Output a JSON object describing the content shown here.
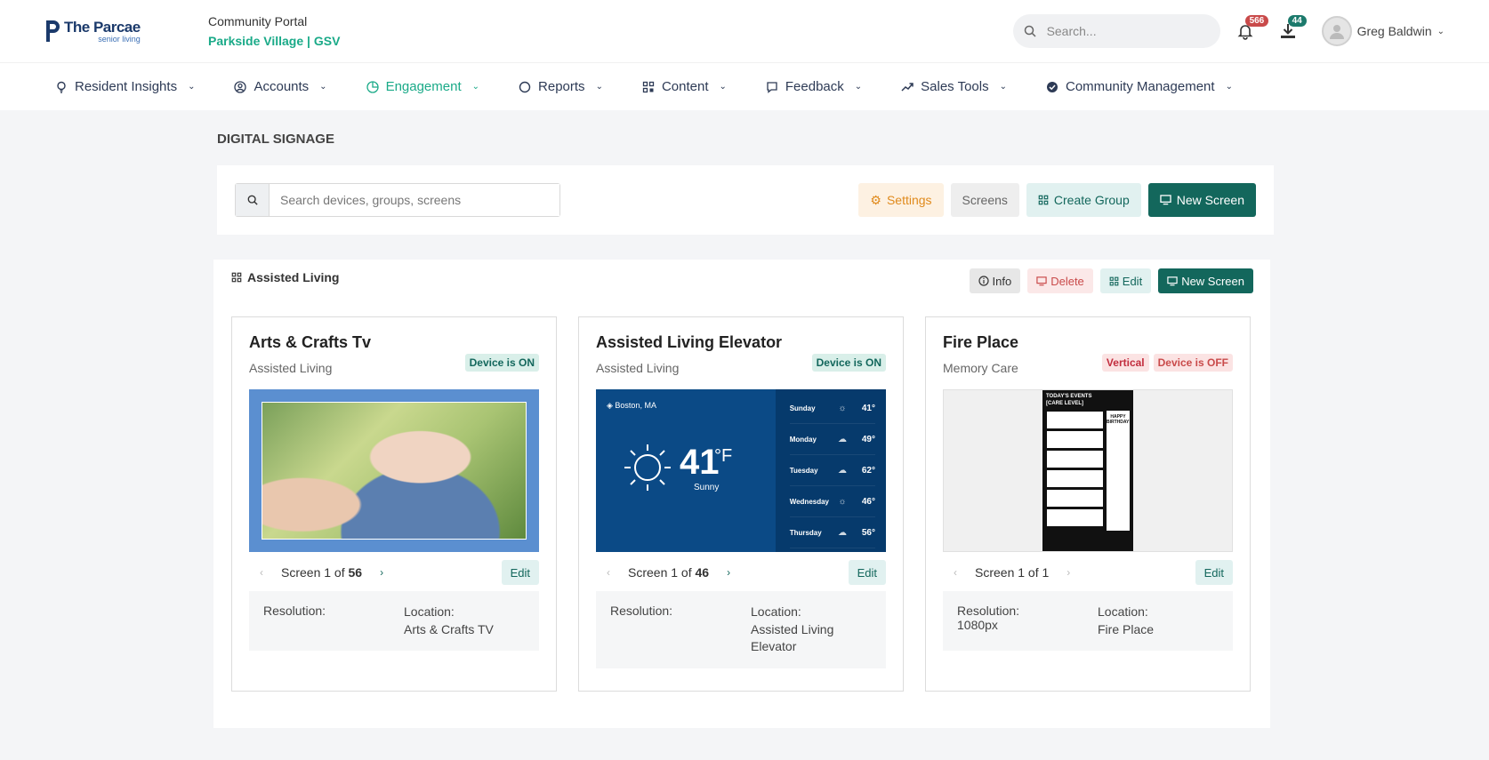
{
  "brand": {
    "name": "The Parcae",
    "tagline": "senior living"
  },
  "portal": {
    "title": "Community Portal",
    "community": "Parkside Village | GSV"
  },
  "header": {
    "search_placeholder": "Search...",
    "notifications_count": "566",
    "downloads_count": "44",
    "user_name": "Greg Baldwin"
  },
  "nav": [
    {
      "label": "Resident Insights",
      "icon": "bulb-icon"
    },
    {
      "label": "Accounts",
      "icon": "user-circle-icon"
    },
    {
      "label": "Engagement",
      "icon": "engagement-icon",
      "active": true
    },
    {
      "label": "Reports",
      "icon": "circle-icon"
    },
    {
      "label": "Content",
      "icon": "grid-icon"
    },
    {
      "label": "Feedback",
      "icon": "comment-icon"
    },
    {
      "label": "Sales Tools",
      "icon": "trend-icon"
    },
    {
      "label": "Community Management",
      "icon": "check-badge-icon"
    }
  ],
  "page": {
    "title": "DIGITAL SIGNAGE"
  },
  "toolbar": {
    "search_placeholder": "Search devices, groups, screens",
    "settings_label": "Settings",
    "screens_label": "Screens",
    "create_group_label": "Create Group",
    "new_screen_label": "New Screen"
  },
  "group": {
    "title": "Assisted Living",
    "info_label": "Info",
    "delete_label": "Delete",
    "edit_label": "Edit",
    "new_screen_label": "New Screen"
  },
  "devices": [
    {
      "name": "Arts & Crafts Tv",
      "group": "Assisted Living",
      "tags": [
        "Device is ON"
      ],
      "screen_prefix": "Screen 1 of ",
      "screen_total": "56",
      "edit_label": "Edit",
      "resolution_label": "Resolution:",
      "resolution": "",
      "location_label": "Location:",
      "location": "Arts & Crafts TV"
    },
    {
      "name": "Assisted Living Elevator",
      "group": "Assisted Living",
      "tags": [
        "Device is ON"
      ],
      "screen_prefix": "Screen 1 of ",
      "screen_total": "46",
      "edit_label": "Edit",
      "resolution_label": "Resolution:",
      "resolution": "",
      "location_label": "Location:",
      "location": "Assisted Living Elevator"
    },
    {
      "name": "Fire Place",
      "group": "Memory Care",
      "tags": [
        "Vertical",
        "Device is OFF"
      ],
      "screen_prefix": "Screen 1 of ",
      "screen_total": "1",
      "edit_label": "Edit",
      "resolution_label": "Resolution:",
      "resolution": "1080px",
      "location_label": "Location:",
      "location": "Fire Place"
    }
  ],
  "weather": {
    "location": "Boston, MA",
    "temp": "41",
    "unit": "°F",
    "condition": "Sunny",
    "forecast": [
      {
        "day": "Sunday",
        "temp": "41°"
      },
      {
        "day": "Monday",
        "temp": "49°"
      },
      {
        "day": "Tuesday",
        "temp": "62°"
      },
      {
        "day": "Wednesday",
        "temp": "46°"
      },
      {
        "day": "Thursday",
        "temp": "56°"
      }
    ]
  },
  "events_preview": {
    "title": "TODAY'S EVENTS",
    "subtitle": "[CARE LEVEL]",
    "side_title": "HAPPY BIRTHDAY!"
  },
  "colors": {
    "accent": "#1aaa88",
    "primary": "#13675c",
    "danger": "#c94a4a",
    "warning": "#e08a1c"
  }
}
